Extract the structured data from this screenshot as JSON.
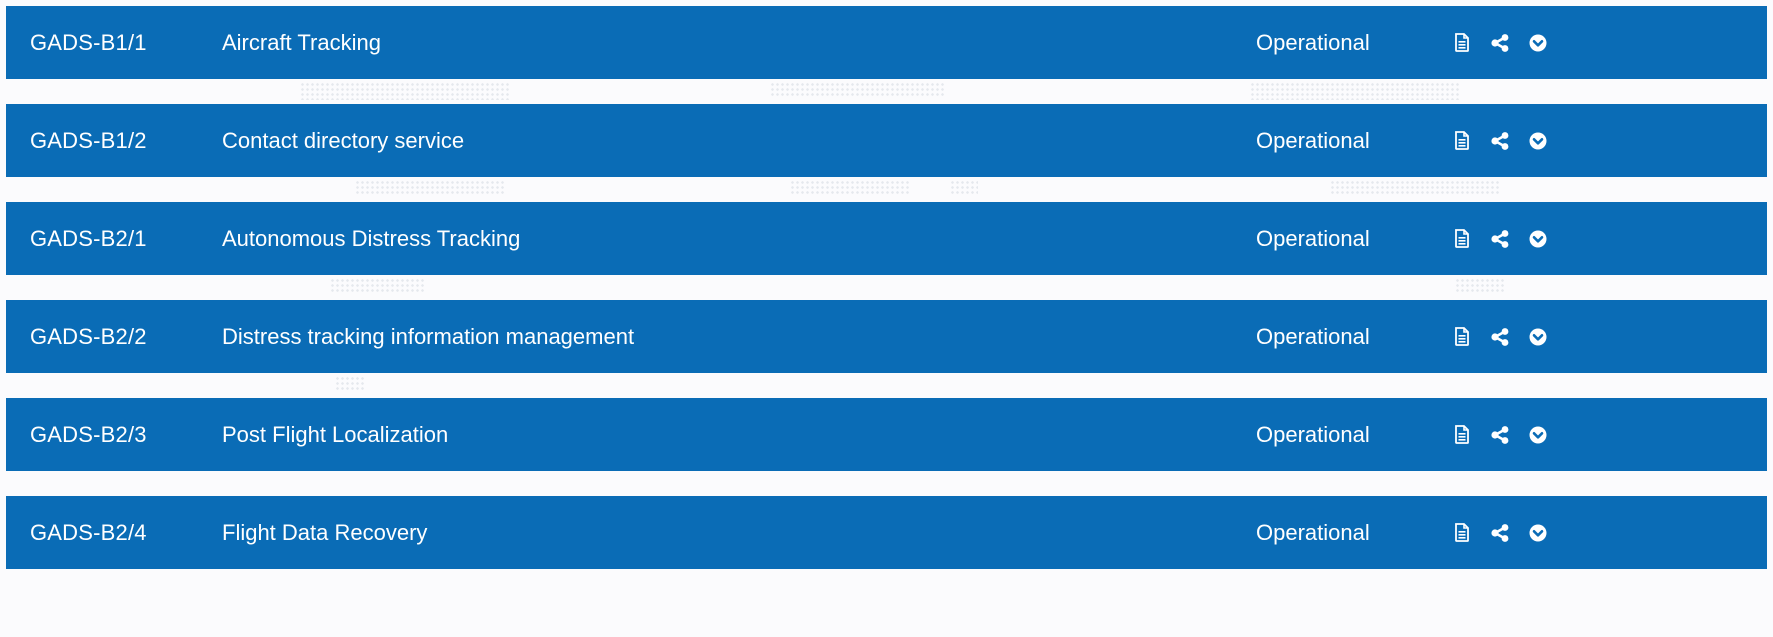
{
  "rows": [
    {
      "code": "GADS-B1/1",
      "title": "Aircraft Tracking",
      "status": "Operational"
    },
    {
      "code": "GADS-B1/2",
      "title": "Contact directory service",
      "status": "Operational"
    },
    {
      "code": "GADS-B2/1",
      "title": "Autonomous Distress Tracking",
      "status": "Operational"
    },
    {
      "code": "GADS-B2/2",
      "title": "Distress tracking information management",
      "status": "Operational"
    },
    {
      "code": "GADS-B2/3",
      "title": "Post Flight Localization",
      "status": "Operational"
    },
    {
      "code": "GADS-B2/4",
      "title": "Flight Data Recovery",
      "status": "Operational"
    }
  ],
  "icons": {
    "document": "document-icon",
    "share": "share-icon",
    "expand": "chevron-circle-down-icon"
  },
  "colors": {
    "row_background": "#0a6cb6",
    "row_text": "#ffffff",
    "page_background": "#fbfbfd"
  }
}
